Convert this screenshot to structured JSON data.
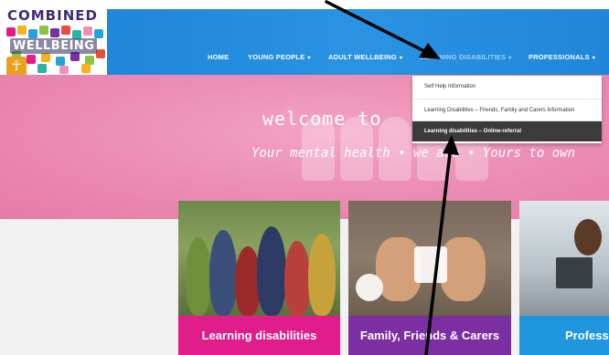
{
  "logo": {
    "word1": "COMBINED",
    "word2": "WELLBEING"
  },
  "nav": {
    "items": [
      {
        "label": "HOME",
        "has_caret": false
      },
      {
        "label": "YOUNG PEOPLE",
        "has_caret": true
      },
      {
        "label": "ADULT WELLBEING",
        "has_caret": true
      },
      {
        "label": "LEARNING DISABILITIES",
        "has_caret": true
      },
      {
        "label": "PROFESSIONALS",
        "has_caret": true
      }
    ],
    "caret": "▾"
  },
  "dropdown": {
    "items": [
      "Self Help Information",
      "Learning Disabilities – Friends, Family and Carers Information",
      "Learning disabilities – Online-referral"
    ],
    "highlighted_index": 2
  },
  "hero": {
    "title": "welcome to",
    "subtitle": "Your mental health • we are • Yours to own"
  },
  "cards": [
    {
      "label": "Learning disabilities",
      "color": "#e11d8c"
    },
    {
      "label": "Family, Friends & Carers",
      "color": "#7b2fa0"
    },
    {
      "label": "Professi",
      "color": "#1f96dd"
    }
  ],
  "colors": {
    "nav_blue": "#1f86da",
    "hero_pink": "#ec8fb6",
    "accessibility_orange": "#e8a21f"
  }
}
